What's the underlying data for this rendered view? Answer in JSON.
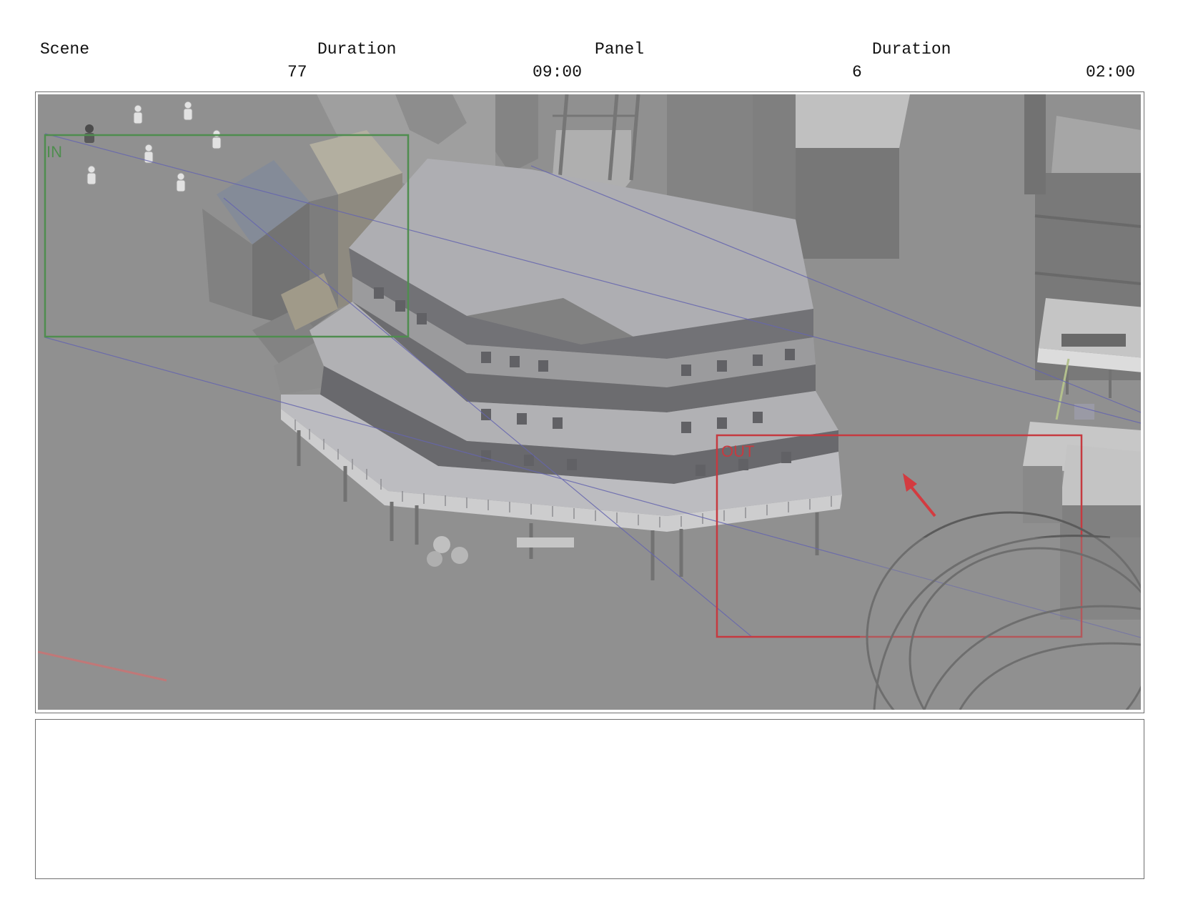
{
  "header": {
    "scene_label": "Scene",
    "scene_duration_label": "Duration",
    "panel_label": "Panel",
    "panel_duration_label": "Duration",
    "scene_number": "77",
    "scene_duration": "09:00",
    "panel_number": "6",
    "panel_duration": "02:00"
  },
  "frame_markers": {
    "in_label": "IN",
    "out_label": "OUT",
    "in_color": "#3f8a3f",
    "out_color": "#d0252c",
    "guide_line_color": "#5a5ab4"
  },
  "notes": {
    "text": ""
  }
}
